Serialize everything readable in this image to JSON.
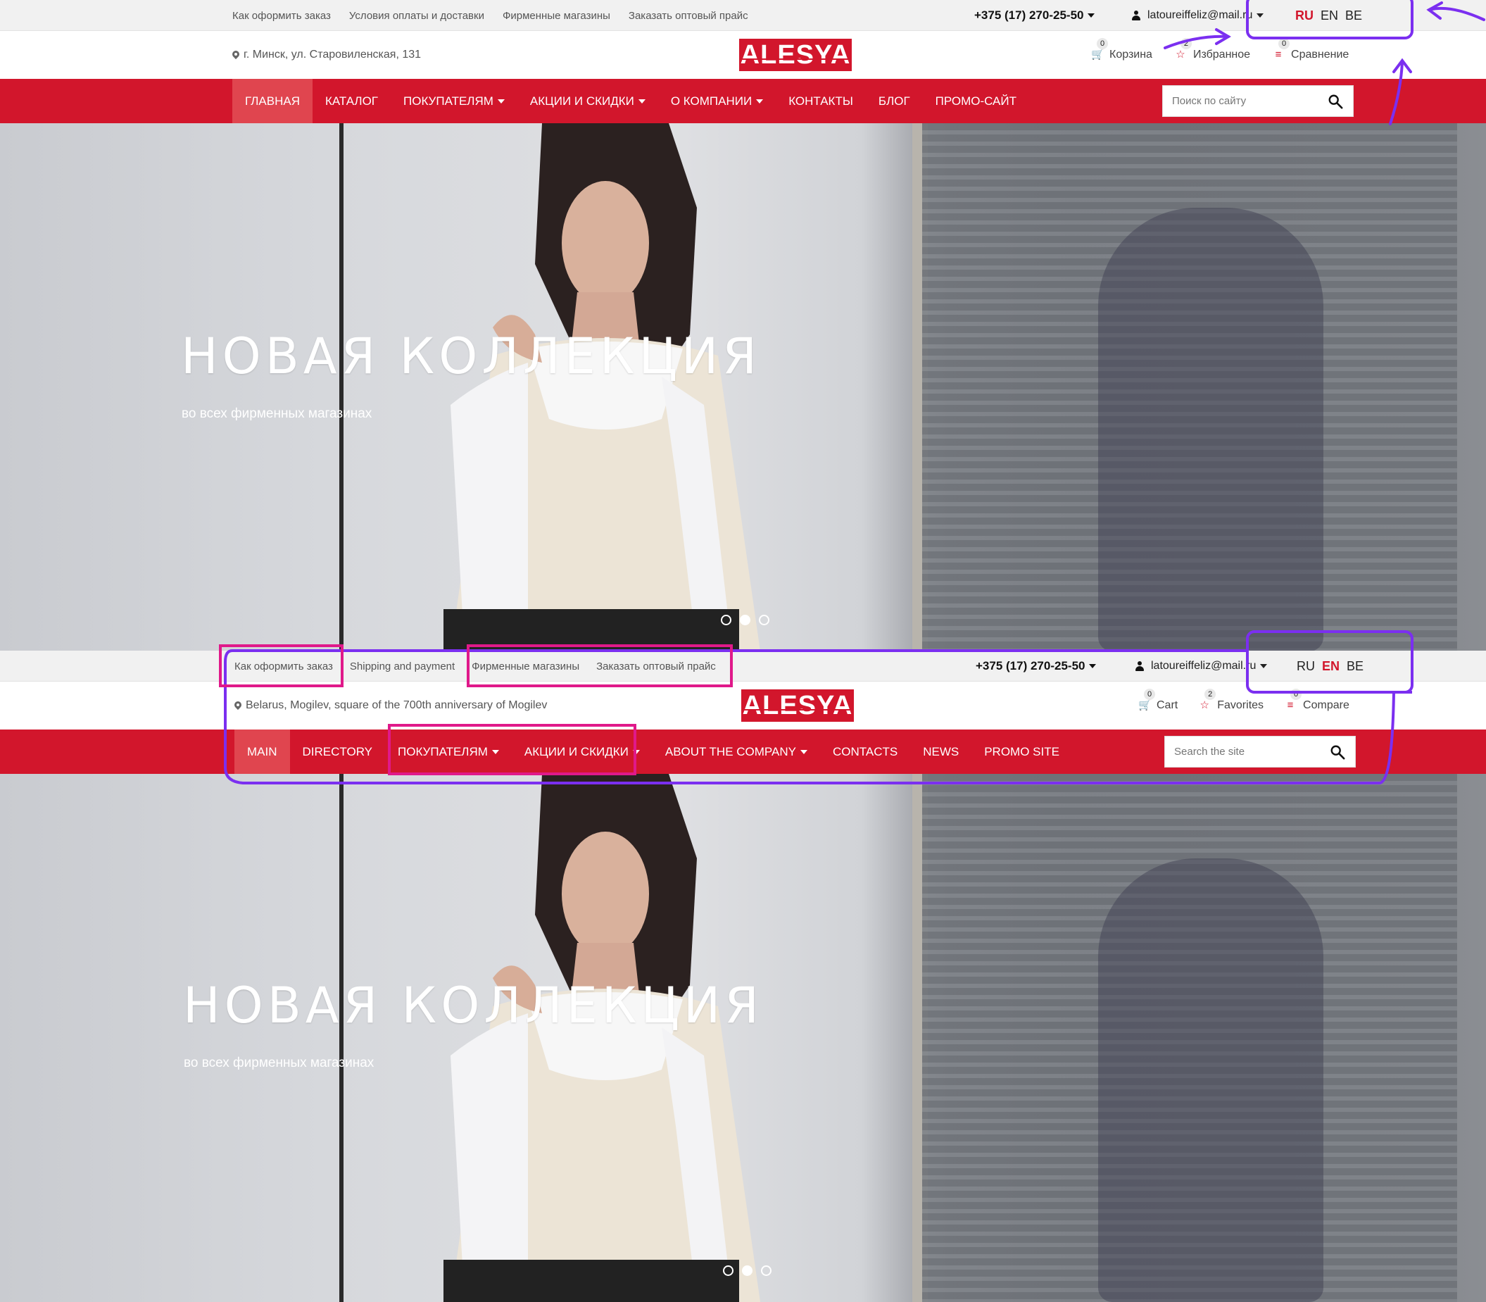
{
  "theme": {
    "accent": "#d2162c",
    "annotation_purple": "#7b2ff0",
    "annotation_pink": "#e0198a"
  },
  "shot_ru": {
    "top_links": [
      "Как оформить заказ",
      "Условия оплаты и доставки",
      "Фирменные магазины",
      "Заказать оптовый прайс"
    ],
    "phone": "+375 (17) 270-25-50",
    "account": "latoureiffeliz@mail.ru",
    "langs": [
      "RU",
      "EN",
      "BE"
    ],
    "active_lang": "RU",
    "address": "г. Минск, ул. Старовиленская, 131",
    "logo": "ALESYA",
    "cart": {
      "label": "Корзина",
      "count": "0"
    },
    "favorites": {
      "label": "Избранное",
      "count": "2"
    },
    "compare": {
      "label": "Сравнение",
      "count": "0"
    },
    "nav": [
      "ГЛАВНАЯ",
      "КАТАЛОГ",
      "ПОКУПАТЕЛЯМ",
      "АКЦИИ И СКИДКИ",
      "О КОМПАНИИ",
      "КОНТАКТЫ",
      "БЛОГ",
      "ПРОМО-САЙТ"
    ],
    "search_placeholder": "Поиск по сайту",
    "hero_title": "НОВАЯ КОЛЛЕКЦИЯ",
    "hero_subtitle": "во всех фирменных магазинах",
    "slides": 3,
    "active_slide": 2
  },
  "shot_en": {
    "top_links": [
      "Как оформить заказ",
      "Shipping and payment",
      "Фирменные магазины",
      "Заказать оптовый прайс"
    ],
    "phone": "+375 (17) 270-25-50",
    "account": "latoureiffeliz@mail.ru",
    "langs": [
      "RU",
      "EN",
      "BE"
    ],
    "active_lang": "EN",
    "address": "Belarus, Mogilev, square of the 700th anniversary of Mogilev",
    "logo": "ALESYA",
    "cart": {
      "label": "Cart",
      "count": "0"
    },
    "favorites": {
      "label": "Favorites",
      "count": "2"
    },
    "compare": {
      "label": "Compare",
      "count": "0"
    },
    "nav": [
      "MAIN",
      "DIRECTORY",
      "ПОКУПАТЕЛЯМ",
      "АКЦИИ И СКИДКИ",
      "ABOUT THE COMPANY",
      "CONTACTS",
      "NEWS",
      "PROMO SITE"
    ],
    "search_placeholder": "Search the site",
    "hero_title": "НОВАЯ КОЛЛЕКЦИЯ",
    "hero_subtitle": "во всех фирменных магазинах",
    "slides": 3,
    "active_slide": 2
  }
}
